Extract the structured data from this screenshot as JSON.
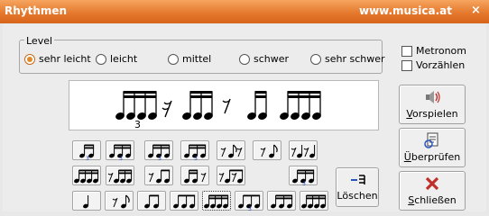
{
  "window": {
    "title": "Rhythmen",
    "url": "www.musica.at",
    "close_symbol": "×"
  },
  "level": {
    "legend": "Level",
    "options": [
      "sehr leicht",
      "leicht",
      "mittel",
      "schwer",
      "sehr schwer"
    ],
    "selected": "sehr leicht"
  },
  "options": {
    "metronome": "Metronom",
    "count_in": "Vorzählen",
    "metronome_checked": false,
    "count_in_checked": false
  },
  "buttons": {
    "play": "Vorspielen",
    "check": "Überprüfen",
    "close": "Schließen",
    "delete": "Löschen"
  },
  "rhythm_display": {
    "groups": [
      "triplet-sixteenths-4-with-3",
      "sixteenth-rest",
      "sixteenths-3",
      "eighth-rest",
      "sixteenths-4",
      "sixteenths-4"
    ],
    "triplet_number": "3"
  },
  "pattern_palette": {
    "row1": [
      "sixteenth-pair-triplet",
      "triplet-sixteenths-grouped",
      "triplet-sixteenths-full",
      "triplet-sixteenths-alt",
      "eighth-rest-eighth",
      "eighth-rest-eighth-dotted",
      "rest-eighth-rest-eighth"
    ],
    "row2": [
      "sixteenths-4",
      "rest-sixteenths-3",
      "rest-eighth-sixteenth",
      "eighth-sixteenth-rest",
      "rest-sixteenth-rest-sixteenth",
      "triplet-eighths"
    ],
    "row3": [
      "quarter",
      "quarter-rest-eighth",
      "eighths-2",
      "eighth-sixteenths-2",
      "sixteenths-4-selected",
      "triplet-eighths-2",
      "sixteenths-2-eighth",
      "sixteenths-4"
    ],
    "selected_index_row3": 4,
    "triplet_number": "3"
  },
  "colors": {
    "titlebar": "#e5792e",
    "triplet_mark": "#1a3fb0",
    "close_x": "#c0302a"
  },
  "icons": [
    "speaker-icon",
    "check-document-icon",
    "close-x-icon",
    "delete-notes-icon"
  ]
}
